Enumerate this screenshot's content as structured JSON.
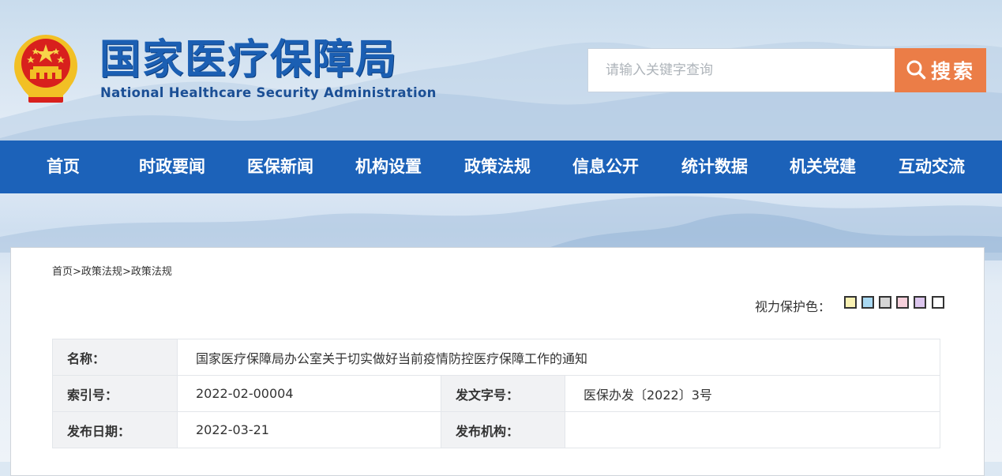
{
  "header": {
    "title_cn": "国家医疗保障局",
    "title_en": "National Healthcare Security Administration",
    "emblem_icon": "national-emblem-icon"
  },
  "search": {
    "placeholder": "请输入关键字查询",
    "button_label": "搜索",
    "button_color": "#eb7d47"
  },
  "nav": {
    "color": "#1c62b9",
    "items": [
      {
        "label": "首页"
      },
      {
        "label": "时政要闻"
      },
      {
        "label": "医保新闻"
      },
      {
        "label": "机构设置"
      },
      {
        "label": "政策法规"
      },
      {
        "label": "信息公开"
      },
      {
        "label": "统计数据"
      },
      {
        "label": "机关党建"
      },
      {
        "label": "互动交流"
      }
    ]
  },
  "breadcrumb": {
    "items": [
      "首页",
      "政策法规",
      "政策法规"
    ],
    "separator": ">"
  },
  "eye_protection": {
    "label": "视力保护色：",
    "colors": [
      "#f9f1b3",
      "#a9d9f2",
      "#d6d6d6",
      "#f6d0db",
      "#dcc6ee",
      "#ffffff"
    ]
  },
  "document": {
    "name_label": "名称：",
    "name_value": "国家医疗保障局办公室关于切实做好当前疫情防控医疗保障工作的通知",
    "index_label": "索引号：",
    "index_value": "2022-02-00004",
    "doc_no_label": "发文字号：",
    "doc_no_value": "医保办发〔2022〕3号",
    "date_label": "发布日期：",
    "date_value": "2022-03-21",
    "issuer_label": "发布机构：",
    "issuer_value": ""
  }
}
